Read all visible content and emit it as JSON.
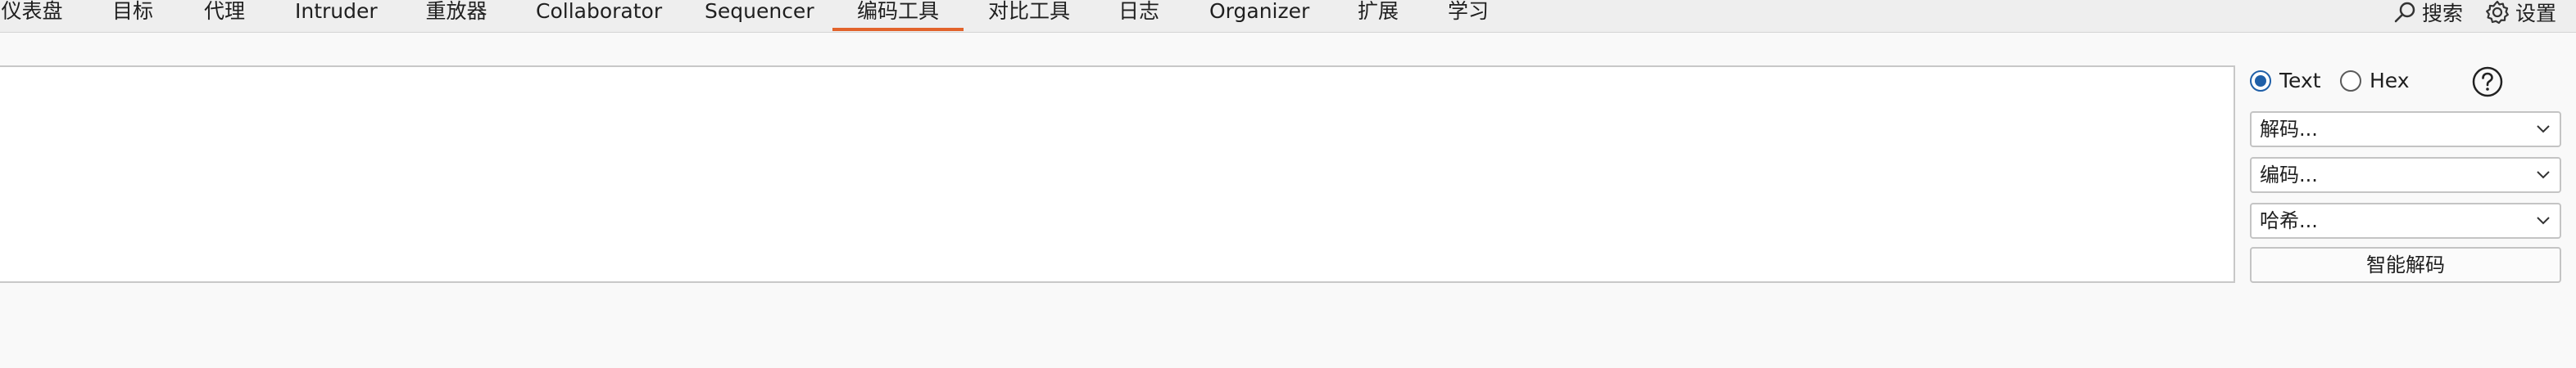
{
  "tabs": [
    {
      "label": "仪表盘"
    },
    {
      "label": "目标"
    },
    {
      "label": "代理"
    },
    {
      "label": "Intruder"
    },
    {
      "label": "重放器"
    },
    {
      "label": "Collaborator"
    },
    {
      "label": "Sequencer"
    },
    {
      "label": "编码工具",
      "active": true
    },
    {
      "label": "对比工具"
    },
    {
      "label": "日志"
    },
    {
      "label": "Organizer"
    },
    {
      "label": "扩展"
    },
    {
      "label": "学习"
    }
  ],
  "toolbar": {
    "search_label": "搜索",
    "settings_label": "设置"
  },
  "editor": {
    "value": ""
  },
  "panel": {
    "mode_text": "Text",
    "mode_hex": "Hex",
    "selected_mode": "Text",
    "decode_label": "解码...",
    "encode_label": "编码...",
    "hash_label": "哈希...",
    "smart_decode_label": "智能解码"
  },
  "colors": {
    "accent": "#e2632b",
    "radio_selected": "#1f5fa8"
  }
}
